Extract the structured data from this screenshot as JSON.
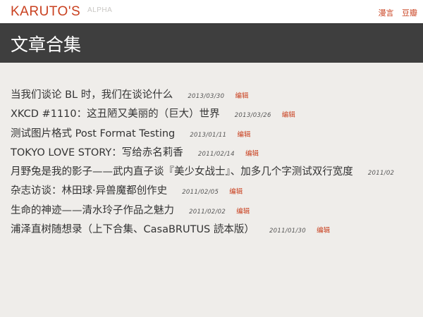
{
  "header": {
    "logo": "KARUTO'S",
    "badge": "ALPHA",
    "nav": [
      "漫言",
      "豆瓣"
    ]
  },
  "page": {
    "title": "文章合集"
  },
  "posts": [
    {
      "title": "当我们谈论 BL 时，我们在谈论什么",
      "date": "2013/03/30",
      "edit": "编辑"
    },
    {
      "title": "XKCD #1110：这丑陋又美丽的（巨大）世界",
      "date": "2013/03/26",
      "edit": "编辑"
    },
    {
      "title": "测试图片格式 Post Format Testing",
      "date": "2013/01/11",
      "edit": "编辑"
    },
    {
      "title": "TOKYO LOVE STORY：写给赤名莉香",
      "date": "2011/02/14",
      "edit": "编辑"
    },
    {
      "title": "月野兔是我的影子——武内直子谈『美少女战士』、加多几个字测试双行宽度",
      "date": "2011/02",
      "edit": ""
    },
    {
      "title": "杂志访谈：林田球·异兽魔都创作史",
      "date": "2011/02/05",
      "edit": "编辑"
    },
    {
      "title": "生命的神迹——清水玲子作品之魅力",
      "date": "2011/02/02",
      "edit": "编辑"
    },
    {
      "title": "浦泽直树随想录（上下合集、CasaBRUTUS 読本版）",
      "date": "2011/01/30",
      "edit": "编辑"
    }
  ]
}
